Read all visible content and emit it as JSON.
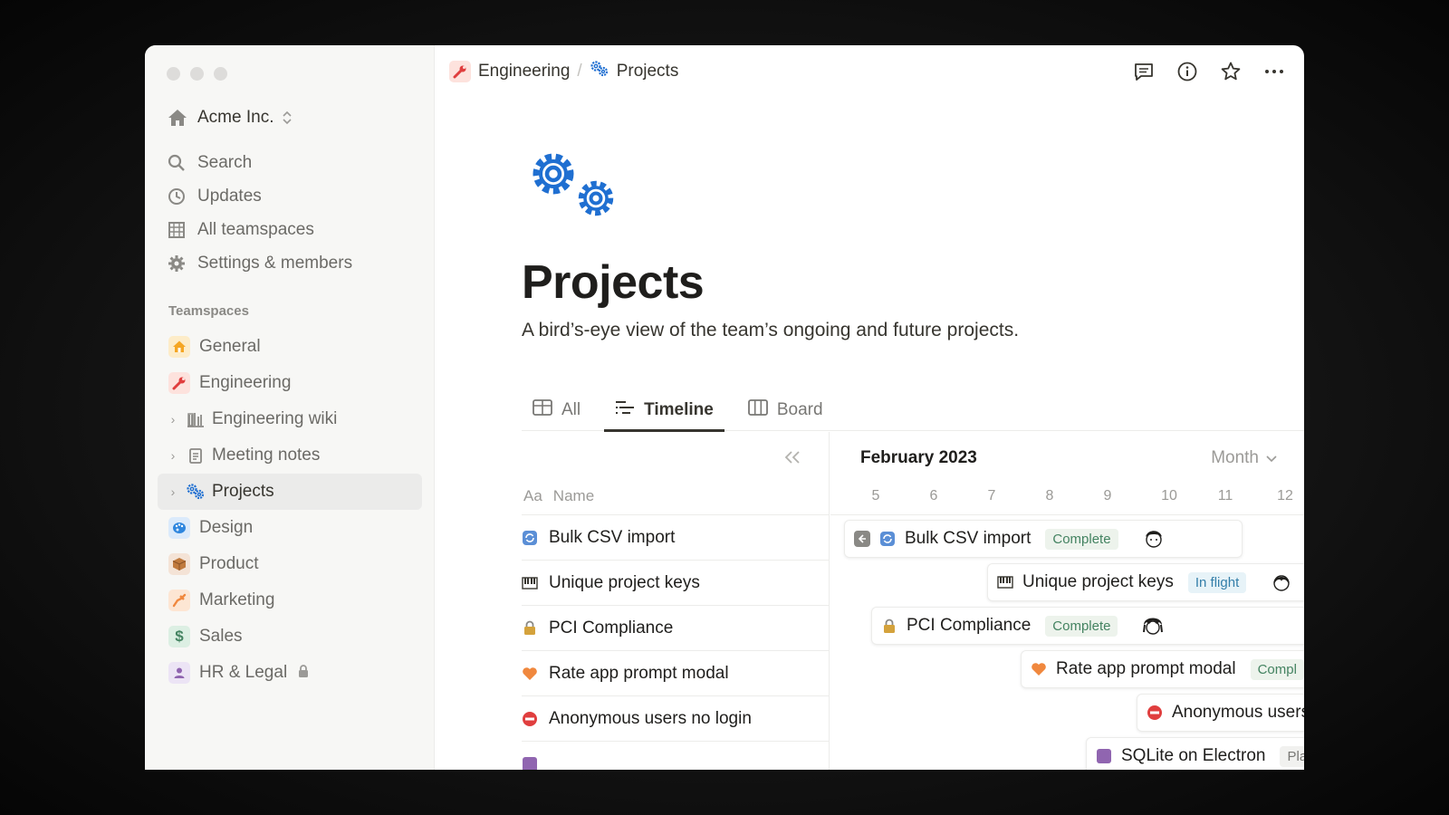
{
  "sidebar": {
    "workspace": "Acme Inc.",
    "nav": [
      {
        "label": "Search",
        "icon": "search-icon"
      },
      {
        "label": "Updates",
        "icon": "clock-icon"
      },
      {
        "label": "All teamspaces",
        "icon": "building-icon"
      },
      {
        "label": "Settings & members",
        "icon": "gear-icon"
      }
    ],
    "section_label": "Teamspaces",
    "teams": [
      {
        "label": "General",
        "icon": "house-icon",
        "color": "#f5a623"
      },
      {
        "label": "Engineering",
        "icon": "wrench-icon",
        "color": "#e03e3e"
      },
      {
        "label": "Engineering wiki",
        "icon": "library-icon"
      },
      {
        "label": "Meeting notes",
        "icon": "notepad-icon"
      },
      {
        "label": "Projects",
        "icon": "gears-icon"
      },
      {
        "label": "Design",
        "icon": "palette-icon",
        "color": "#2e86de"
      },
      {
        "label": "Product",
        "icon": "package-icon",
        "color": "#c07a3e"
      },
      {
        "label": "Marketing",
        "icon": "megaphone-icon",
        "color": "#f0883e"
      },
      {
        "label": "Sales",
        "icon": "dollar-icon",
        "color": "#448361"
      },
      {
        "label": "HR & Legal",
        "icon": "person-icon",
        "color": "#9065b0"
      }
    ]
  },
  "breadcrumb": {
    "parent": "Engineering",
    "sep": "/",
    "current": "Projects"
  },
  "page": {
    "title": "Projects",
    "description": "A bird’s-eye view of the team’s ongoing and future projects."
  },
  "tabs": [
    {
      "label": "All",
      "icon": "table-icon"
    },
    {
      "label": "Timeline",
      "icon": "timeline-icon"
    },
    {
      "label": "Board",
      "icon": "board-icon"
    }
  ],
  "table": {
    "name_prefix": "Aa",
    "name_header": "Name",
    "rows": [
      {
        "name": "Bulk CSV import",
        "icon": "refresh-icon"
      },
      {
        "name": "Unique project keys",
        "icon": "piano-icon"
      },
      {
        "name": "PCI Compliance",
        "icon": "lock-icon"
      },
      {
        "name": "Rate app prompt modal",
        "icon": "heart-icon"
      },
      {
        "name": "Anonymous users no login",
        "icon": "no-entry-icon"
      }
    ]
  },
  "timeline": {
    "month": "February 2023",
    "scale": "Month",
    "days": [
      "5",
      "6",
      "7",
      "8",
      "9",
      "10",
      "11",
      "12"
    ],
    "bars": [
      {
        "name": "Bulk CSV import",
        "status": "Complete"
      },
      {
        "name": "Unique project keys",
        "status": "In flight"
      },
      {
        "name": "PCI Compliance",
        "status": "Complete"
      },
      {
        "name": "Rate app prompt modal",
        "status": "Compl"
      },
      {
        "name": "Anonymous users",
        "status": ""
      },
      {
        "name": "SQLite on Electron",
        "status": "Pla"
      }
    ]
  },
  "colors": {
    "accent_blue": "#1f6fd1",
    "status_complete_bg": "#edf3ec",
    "status_flight_bg": "#e7f3f8"
  }
}
